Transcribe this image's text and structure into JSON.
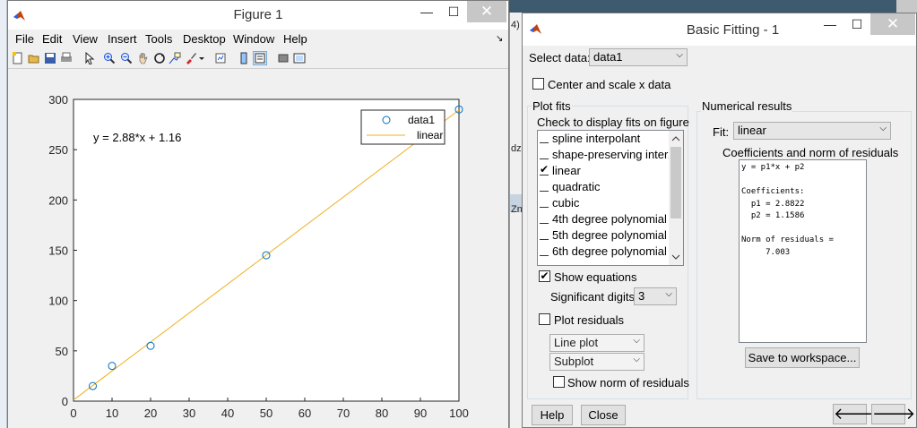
{
  "figure": {
    "title": "Figure 1",
    "menu": [
      "File",
      "Edit",
      "View",
      "Insert",
      "Tools",
      "Desktop",
      "Window",
      "Help"
    ],
    "dock_arrow": "↘",
    "min_glyph": "—",
    "max_glyph": "☐",
    "close_glyph": "✕"
  },
  "background_text": {
    "fragment_1": "4)",
    "fragment_2": "dz",
    "fragment_3": "Zn"
  },
  "chart_data": {
    "type": "scatter",
    "title": "",
    "xlabel": "",
    "ylabel": "",
    "xlim": [
      0,
      100
    ],
    "ylim": [
      0,
      300
    ],
    "xticks": [
      0,
      10,
      20,
      30,
      40,
      50,
      60,
      70,
      80,
      90,
      100
    ],
    "yticks": [
      0,
      50,
      100,
      150,
      200,
      250,
      300
    ],
    "grid": false,
    "legend_position": "top-right",
    "annotation": "y = 2.88*x + 1.16",
    "series": [
      {
        "name": "data1",
        "kind": "markers",
        "marker": "circle",
        "color": "#0072bd",
        "x": [
          5,
          10,
          20,
          50,
          100
        ],
        "y": [
          15,
          35,
          55,
          145,
          290
        ]
      },
      {
        "name": "linear",
        "kind": "line",
        "color": "#edb120",
        "slope": 2.8822,
        "intercept": 1.1586,
        "x_range": [
          0,
          100
        ]
      }
    ]
  },
  "fitting": {
    "title": "Basic Fitting - 1",
    "select_data_label": "Select data:",
    "select_data_value": "data1",
    "center_scale_label": "Center and scale x data",
    "plot_fits_title": "Plot fits",
    "check_display_label": "Check to display fits on figure",
    "fits": [
      {
        "label": "spline interpolant",
        "checked": false
      },
      {
        "label": "shape-preserving inter...",
        "checked": false
      },
      {
        "label": "linear",
        "checked": true
      },
      {
        "label": "quadratic",
        "checked": false
      },
      {
        "label": "cubic",
        "checked": false
      },
      {
        "label": "4th degree polynomial",
        "checked": false
      },
      {
        "label": "5th degree polynomial",
        "checked": false
      },
      {
        "label": "6th degree polynomial",
        "checked": false
      }
    ],
    "show_equations_label": "Show equations",
    "sig_digits_label": "Significant digits:",
    "sig_digits_value": "3",
    "plot_residuals_label": "Plot residuals",
    "residual_plot_type": "Line plot",
    "residual_location": "Subplot",
    "show_norm_label": "Show norm of residuals",
    "numerical_results_title": "Numerical results",
    "fit_label": "Fit:",
    "fit_value": "linear",
    "coef_title": "Coefficients and norm of residuals",
    "results_text": "y = p1*x + p2\n\nCoefficients:\n  p1 = 2.8822\n  p2 = 1.1586\n\nNorm of residuals =\n     7.003",
    "save_button": "Save to workspace...",
    "help_button": "Help",
    "close_button": "Close",
    "back_arrow": "🡐",
    "forward_arrow": "🡒",
    "check_glyph": "✔"
  }
}
